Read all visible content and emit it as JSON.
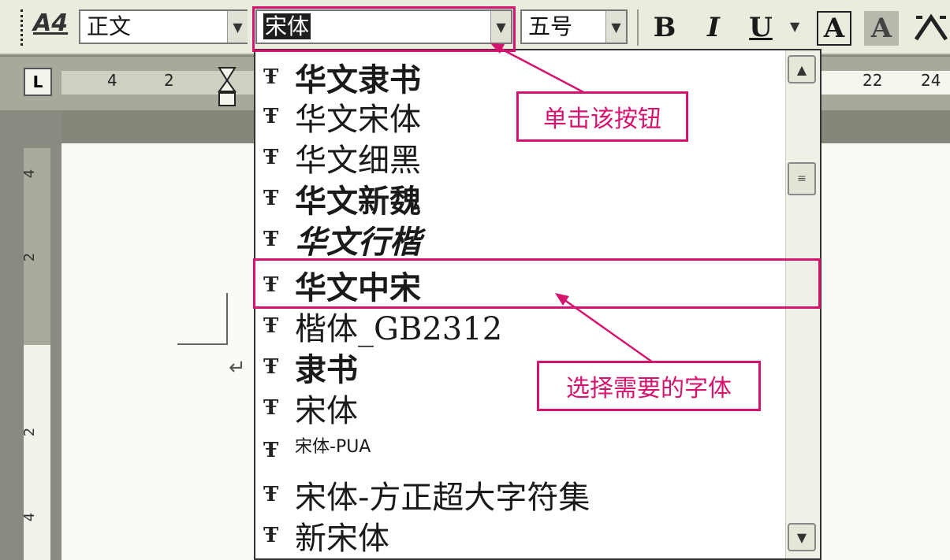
{
  "toolbar": {
    "style_value": "正文",
    "font_value": "宋体",
    "size_value": "五号",
    "bold_label": "B",
    "italic_label": "I",
    "underline_label": "U",
    "char_border_label": "A",
    "char_shading_label": "A",
    "style_icon_label": "A4"
  },
  "ruler": {
    "corner_label": "L",
    "numbers_left": [
      "4",
      "2"
    ],
    "numbers_right": [
      "22",
      "24"
    ]
  },
  "vruler": {
    "numbers": [
      "4",
      "2",
      "2",
      "4"
    ]
  },
  "dropdown": {
    "icon_glyph": "Ŧ",
    "fonts": [
      "华文隶书",
      "华文宋体",
      "华文细黑",
      "华文新魏",
      "华文行楷",
      "华文中宋",
      "楷体_GB2312",
      "隶书",
      "宋体",
      "宋体-PUA",
      "宋体-方正超大字符集",
      "新宋体"
    ],
    "selected": "华文中宋"
  },
  "annotations": {
    "callout_click": "单击该按钮",
    "callout_choose": "选择需要的字体"
  },
  "colors": {
    "annotation": "#d6146e",
    "toolbar_bg": "#ececde"
  }
}
